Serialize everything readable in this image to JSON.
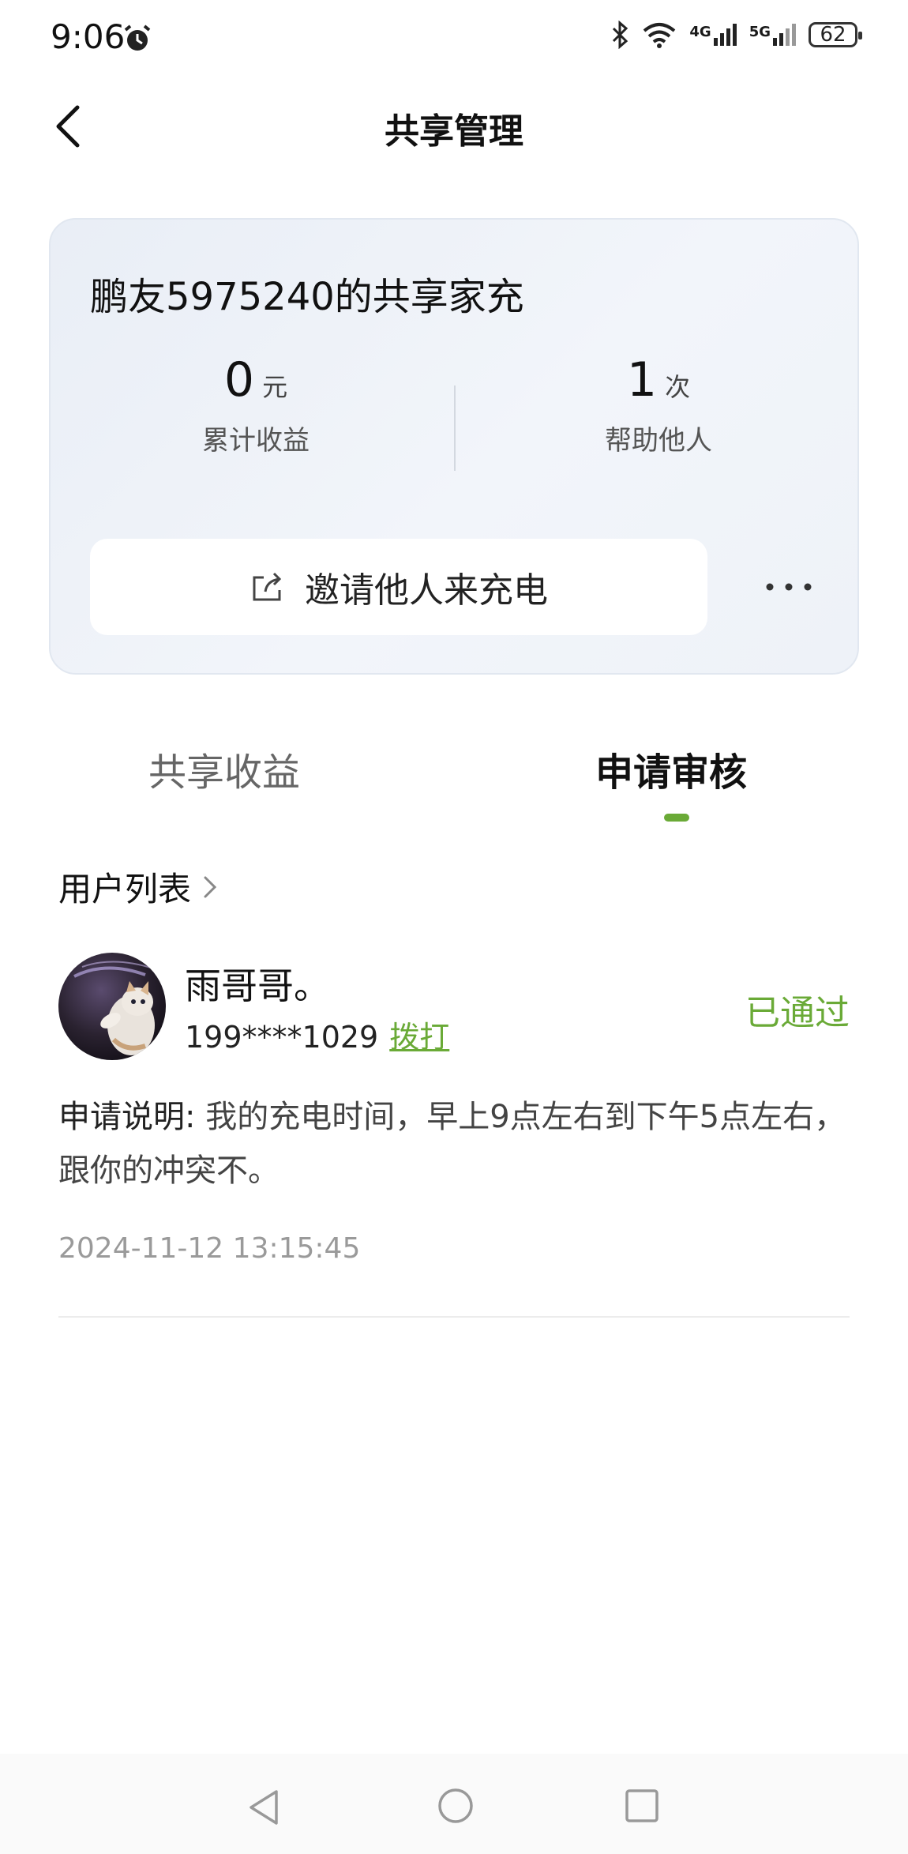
{
  "status_bar": {
    "time": "9:06",
    "network_4g": "4G",
    "network_5g": "5G",
    "battery": "62",
    "icons": [
      "alarm-icon",
      "bluetooth-icon",
      "wifi-icon",
      "signal-4g-icon",
      "signal-5g-icon",
      "battery-icon"
    ]
  },
  "header": {
    "title": "共享管理"
  },
  "card": {
    "title": "鹏友5975240的共享家充",
    "stats": {
      "income_value": "0",
      "income_unit": "元",
      "income_label": "累计收益",
      "help_value": "1",
      "help_unit": "次",
      "help_label": "帮助他人"
    },
    "invite_button": "邀请他人来充电"
  },
  "tabs": [
    {
      "label": "共享收益",
      "active": false
    },
    {
      "label": "申请审核",
      "active": true
    }
  ],
  "accent_color": "#6aaa37",
  "user_list": {
    "title": "用户列表",
    "entries": [
      {
        "name": "雨哥哥。",
        "phone": "199****1029",
        "call_label": "拨打",
        "status": "已通过",
        "note_label": "申请说明:",
        "note": " 我的充电时间，早上9点左右到下午5点左右，跟你的冲突不。",
        "time": "2024-11-12 13:15:45"
      }
    ]
  }
}
